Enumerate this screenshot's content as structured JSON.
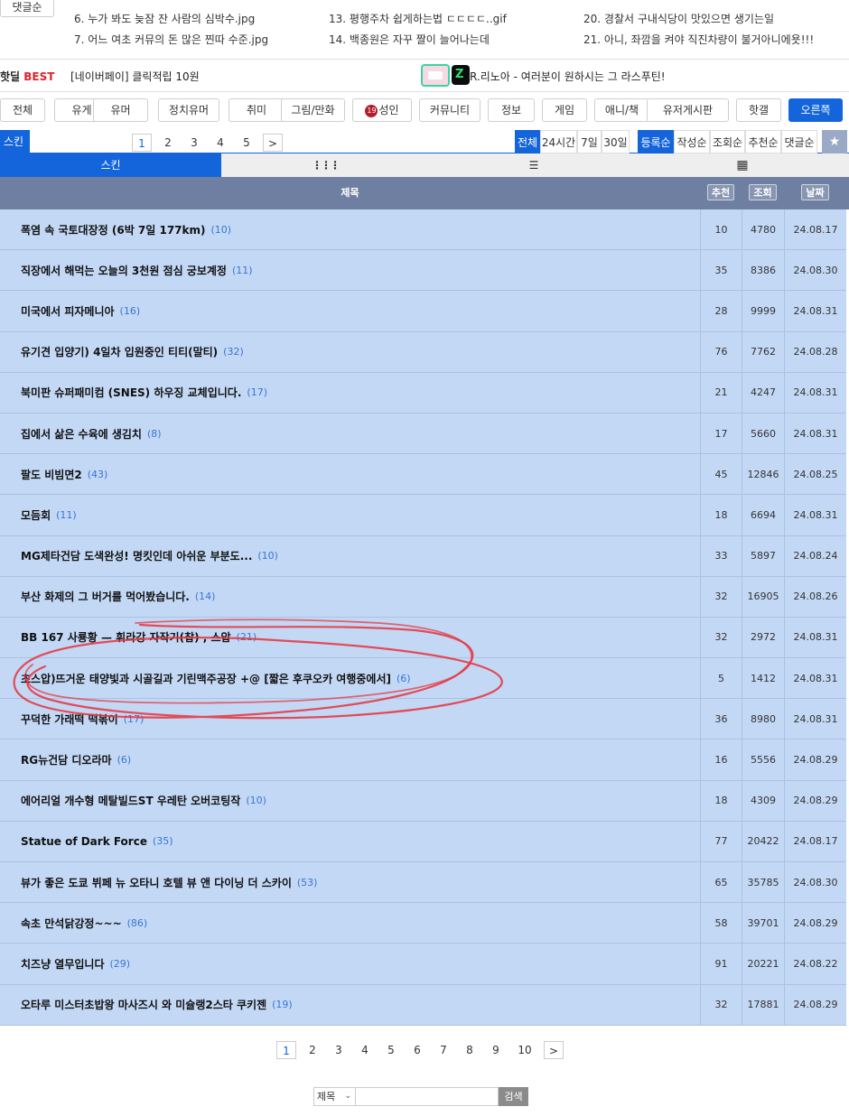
{
  "top_ranking": {
    "sort_label": "댓글순",
    "col1": [
      "6. 누가 봐도 늦잠 잔 사람의 심박수.jpg",
      "7. 어느 여초 커뮤의 돈 많은 찐따 수준.jpg"
    ],
    "col2": [
      "13. 평행주차 쉽게하는법 ㄷㄷㄷㄷ..gif",
      "14. 백종원은 자꾸 짤이 늘어나는데"
    ],
    "col3": [
      "20. 경찰서 구내식당이 맛있으면 생기는일",
      "21. 아니, 좌깜을 켜야 직진차량이 불거아니에욧!!!"
    ]
  },
  "best": {
    "logo_prefix": "핫딜",
    "logo_best": "BEST",
    "ad_text": "[네이버페이] 클릭적립 10원",
    "icon_letter": "Z",
    "headline": "R.리노아 - 여러분이 원하시는 그 라스푸틴!"
  },
  "categories": [
    {
      "label": "전체",
      "active": false
    },
    {
      "label": "유게",
      "active": false
    },
    {
      "label": "유머",
      "active": false
    },
    {
      "label": "정치유머",
      "active": false
    },
    {
      "label": "취미",
      "active": false
    },
    {
      "label": "그림/만화",
      "active": false
    },
    {
      "label": "성인",
      "active": false,
      "badge": "19"
    },
    {
      "label": "커뮤니티",
      "active": false
    },
    {
      "label": "정보",
      "active": false
    },
    {
      "label": "게임",
      "active": false
    },
    {
      "label": "애니/책",
      "active": false
    },
    {
      "label": "유저게시판",
      "active": false
    },
    {
      "label": "핫갤",
      "active": false
    },
    {
      "label": "오른쪽",
      "active": true
    }
  ],
  "skin_row": {
    "skin_label": "스킨",
    "pages": [
      "1",
      "2",
      "3",
      "4",
      "5"
    ],
    "current_page": "1",
    "next": ">",
    "period_filters": [
      "전체",
      "24시간",
      "7일",
      "30일"
    ],
    "active_period": "전체",
    "sort_filters": [
      "등록순",
      "작성순",
      "조회순",
      "추천순",
      "댓글순"
    ],
    "active_sort": "등록순",
    "star": "★"
  },
  "view_tabs": {
    "skin": "스킨",
    "grid_icon": "⋮⋮⋮",
    "list_icon": "☰",
    "tile_icon": "▦"
  },
  "table": {
    "headers": {
      "title": "제목",
      "recommend": "추천",
      "views": "조회",
      "date": "날짜"
    },
    "rows": [
      {
        "title": "폭염 속 국토대장정 (6박 7일 177km)",
        "comments": "(10)",
        "rec": "10",
        "views": "4780",
        "date": "24.08.17"
      },
      {
        "title": "직장에서 해먹는 오늘의 3천원 점심 궁보계정",
        "comments": "(11)",
        "rec": "35",
        "views": "8386",
        "date": "24.08.30"
      },
      {
        "title": "미국에서 피자메니아",
        "comments": "(16)",
        "rec": "28",
        "views": "9999",
        "date": "24.08.31"
      },
      {
        "title": "유기견 입양기) 4일차 입원중인 티티(말티)",
        "comments": "(32)",
        "rec": "76",
        "views": "7762",
        "date": "24.08.28"
      },
      {
        "title": "북미판 슈퍼패미컴 (SNES) 하우징 교체입니다.",
        "comments": "(17)",
        "rec": "21",
        "views": "4247",
        "date": "24.08.31"
      },
      {
        "title": "집에서 삶은 수육에 생김치",
        "comments": "(8)",
        "rec": "17",
        "views": "5660",
        "date": "24.08.31"
      },
      {
        "title": "팔도 비빔면2",
        "comments": "(43)",
        "rec": "45",
        "views": "12846",
        "date": "24.08.25"
      },
      {
        "title": "모듬회",
        "comments": "(11)",
        "rec": "18",
        "views": "6694",
        "date": "24.08.31"
      },
      {
        "title": "MG제타건담 도색완성! 명킷인데 아쉬운 부분도...",
        "comments": "(10)",
        "rec": "33",
        "views": "5897",
        "date": "24.08.24"
      },
      {
        "title": "부산 화제의 그 버거를 먹어봤습니다.",
        "comments": "(14)",
        "rec": "32",
        "views": "16905",
        "date": "24.08.26"
      },
      {
        "title": "BB 167 사룡황 — 휘라강 자작기(찹) , 스압",
        "comments": "(21)",
        "rec": "32",
        "views": "2972",
        "date": "24.08.31"
      },
      {
        "title": "초스압)뜨거운 태양빛과 시골길과 기린맥주공장 +@ [짧은 후쿠오카 여행중에서]",
        "comments": "(6)",
        "rec": "5",
        "views": "1412",
        "date": "24.08.31"
      },
      {
        "title": "꾸덕한 가래떡 떡볶이",
        "comments": "(17)",
        "rec": "36",
        "views": "8980",
        "date": "24.08.31"
      },
      {
        "title": "RG뉴건담 디오라마",
        "comments": "(6)",
        "rec": "16",
        "views": "5556",
        "date": "24.08.29"
      },
      {
        "title": "에어리얼 개수형 메탈빌드ST 우레탄 오버코팅작",
        "comments": "(10)",
        "rec": "18",
        "views": "4309",
        "date": "24.08.29"
      },
      {
        "title": "Statue of Dark Force",
        "comments": "(35)",
        "rec": "77",
        "views": "20422",
        "date": "24.08.17"
      },
      {
        "title": "뷰가 좋은 도쿄 뷔페 뉴 오타니 호텔 뷰 앤 다이닝 더 스카이",
        "comments": "(53)",
        "rec": "65",
        "views": "35785",
        "date": "24.08.30"
      },
      {
        "title": "속초 만석닭강정~~~",
        "comments": "(86)",
        "rec": "58",
        "views": "39701",
        "date": "24.08.29"
      },
      {
        "title": "치즈냥 열무입니다",
        "comments": "(29)",
        "rec": "91",
        "views": "20221",
        "date": "24.08.22"
      },
      {
        "title": "오타루 미스터초밥왕 마사즈시 와 미슐랭2스타 쿠키젠",
        "comments": "(19)",
        "rec": "32",
        "views": "17881",
        "date": "24.08.29"
      }
    ]
  },
  "bottom_pager": {
    "pages": [
      "1",
      "2",
      "3",
      "4",
      "5",
      "6",
      "7",
      "8",
      "9",
      "10"
    ],
    "current_page": "1",
    "next": ">"
  },
  "search": {
    "field_option": "제목",
    "input_value": "",
    "button_label": "검색"
  },
  "colors": {
    "accent": "#1464dc",
    "row_bg": "#c3d8f5",
    "header_bg": "#6f7fa2",
    "comment_count": "#3a74d6",
    "annotation": "#e8323c"
  }
}
